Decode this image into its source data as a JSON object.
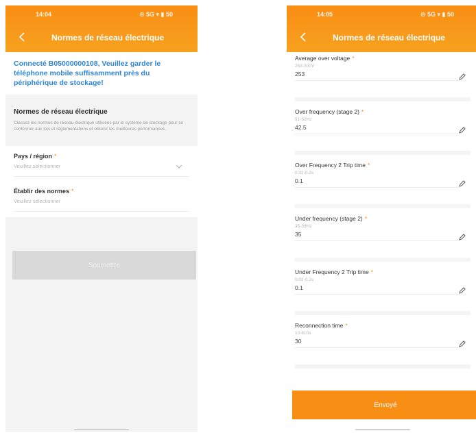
{
  "colors": {
    "accent": "#f98e14",
    "link": "#2f86d6",
    "disabled": "#d9d9d9"
  },
  "left": {
    "status": {
      "time": "14:04",
      "icons": "⊙ 5G ▾ ▮ 50"
    },
    "header": {
      "title": "Normes de réseau électrique",
      "back_icon": "chevron-left-icon"
    },
    "notice": "Connecté B05000000108, Veuillez garder le téléphone mobile suffisamment près du périphérique de stockage!",
    "section": {
      "title": "Normes de réseau électrique",
      "desc": "Classez les normes de réseau électrique utilisées par le système de stockage pour se conformer aux lois et réglementations et obtenir les meilleures performances."
    },
    "country": {
      "label": "Pays / région",
      "required": "*",
      "placeholder": "Veuillez sélectionner"
    },
    "standard": {
      "label": "Établir des normes",
      "required": "*",
      "placeholder": "Veuillez sélectionner"
    },
    "submit_label": "Soumettre"
  },
  "right": {
    "status": {
      "time": "14:05",
      "icons": "⊙ 5G ▾ ▮ 50"
    },
    "header": {
      "title": "Normes de réseau électrique",
      "back_icon": "chevron-left-icon"
    },
    "params": [
      {
        "label": "Average over voltage",
        "required": "*",
        "range": "253-300V",
        "value": "253"
      },
      {
        "label": "Over frequency (stage 2)",
        "required": "*",
        "range": "51-52Hz",
        "value": "42.5"
      },
      {
        "label": "Over Frequency 2 Trip time",
        "required": "*",
        "range": "0.02-0.2s",
        "value": "0.1"
      },
      {
        "label": "Under frequency (stage 2)",
        "required": "*",
        "range": "35-39Hz",
        "value": "35"
      },
      {
        "label": "Under Frequency 2 Trip time",
        "required": "*",
        "range": "0.02-0.2s",
        "value": "0.1"
      },
      {
        "label": "Reconnection time",
        "required": "*",
        "range": "10-610s",
        "value": "30"
      }
    ],
    "save_label": "Envoyé"
  }
}
